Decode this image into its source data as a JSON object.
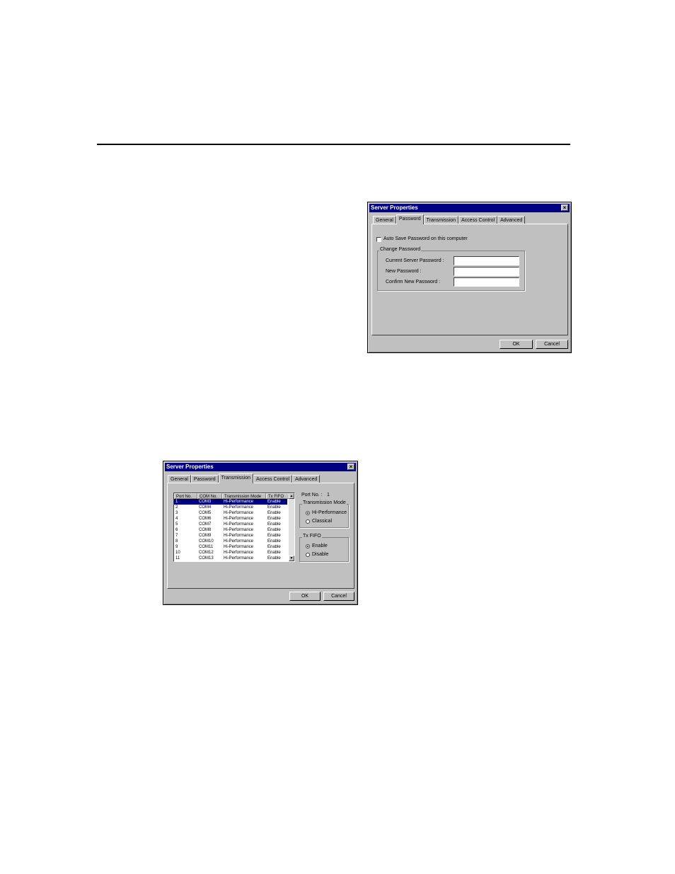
{
  "dialog1": {
    "title": "Server Properties",
    "tabs": [
      "General",
      "Password",
      "Transmission",
      "Access Control",
      "Advanced"
    ],
    "active_tab": "Password",
    "auto_save_label": "Auto Save Password on this computer",
    "group_label": "Change Password",
    "fields": [
      {
        "label": "Current Server Password :",
        "value": ""
      },
      {
        "label": "New Password :",
        "value": ""
      },
      {
        "label": "Confirm New Password :",
        "value": ""
      }
    ],
    "ok_label": "OK",
    "cancel_label": "Cancel"
  },
  "dialog2": {
    "title": "Server Properties",
    "tabs": [
      "General",
      "Password",
      "Transmission",
      "Access Control",
      "Advanced"
    ],
    "active_tab": "Transmission",
    "columns": [
      "Port No.",
      "COM No.",
      "Transmission Mode",
      "Tx FIFO"
    ],
    "rows": [
      [
        "1",
        "COM3",
        "Hi-Performance",
        "Enable"
      ],
      [
        "2",
        "COM4",
        "Hi-Performance",
        "Enable"
      ],
      [
        "3",
        "COM5",
        "Hi-Performance",
        "Enable"
      ],
      [
        "4",
        "COM6",
        "Hi-Performance",
        "Enable"
      ],
      [
        "5",
        "COM7",
        "Hi-Performance",
        "Enable"
      ],
      [
        "6",
        "COM8",
        "Hi-Performance",
        "Enable"
      ],
      [
        "7",
        "COM9",
        "Hi-Performance",
        "Enable"
      ],
      [
        "8",
        "COM10",
        "Hi-Performance",
        "Enable"
      ],
      [
        "9",
        "COM11",
        "Hi-Performance",
        "Enable"
      ],
      [
        "10",
        "COM12",
        "Hi-Performance",
        "Enable"
      ],
      [
        "11",
        "COM13",
        "Hi-Performance",
        "Enable"
      ]
    ],
    "port_no_label": "Port No. :",
    "port_no_value": "1",
    "mode_group": "Transmission Mode",
    "mode_options": [
      "Hi-Performance",
      "Classical"
    ],
    "fifo_group": "Tx FIFO",
    "fifo_options": [
      "Enable",
      "Disable"
    ],
    "ok_label": "OK",
    "cancel_label": "Cancel"
  }
}
